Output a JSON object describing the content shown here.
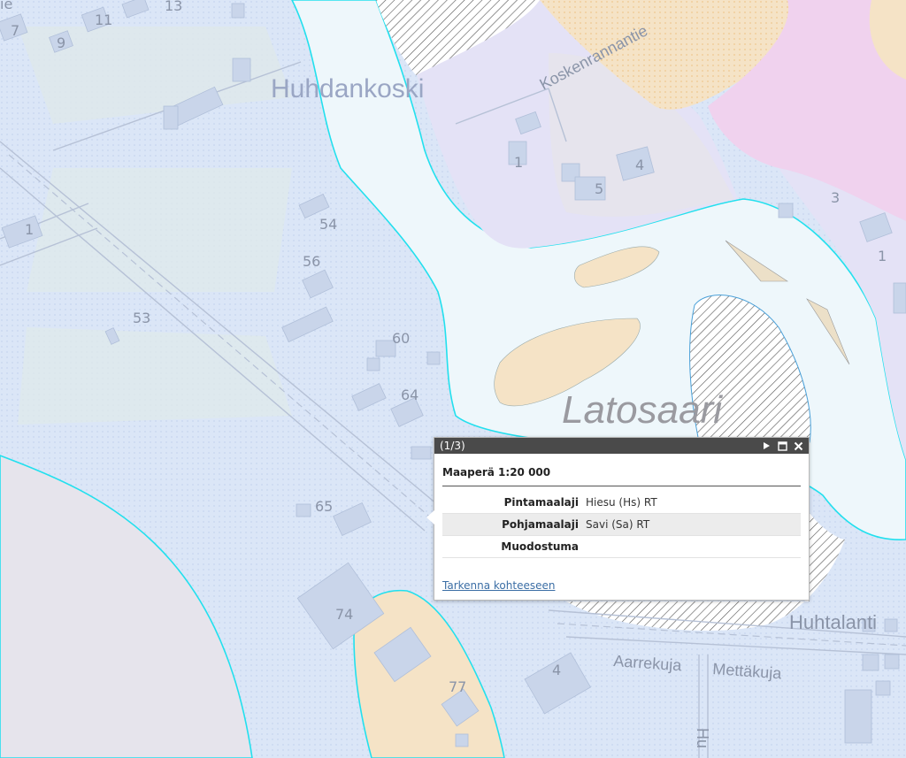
{
  "map": {
    "place_labels": {
      "huhdankoski": "Huhdankoski",
      "latosaari": "Latosaari"
    },
    "road_labels": {
      "koskenrannantie": "Koskenrannantie",
      "huhtalantie": "Huhtalanti",
      "aarrekuja": "Aarrekuja",
      "mettakuja": "Mettäkuja",
      "vertical": "Hu"
    },
    "address_numbers": [
      "7",
      "9",
      "11",
      "13",
      "1",
      "54",
      "56",
      "53",
      "60",
      "64",
      "65",
      "74",
      "77",
      "4",
      "1",
      "5",
      "4",
      "3",
      "1",
      "ie"
    ],
    "colors": {
      "water": "#eef7fb",
      "soil_blue": "#dbe6f7",
      "soil_purple": "#e4e2f6",
      "soil_pink": "#f0d2ee",
      "sand": "#f5e3c6",
      "sand_dots": "#f2cfa0",
      "gray": "#e6e4ec",
      "outline": "#22e0ee"
    }
  },
  "popup": {
    "counter": "(1/3)",
    "title": "Maaperä 1:20 000",
    "rows": [
      {
        "key": "Pintamaalaji",
        "value": "Hiesu (Hs) RT"
      },
      {
        "key": "Pohjamaalaji",
        "value": "Savi (Sa) RT"
      },
      {
        "key": "Muodostuma",
        "value": ""
      }
    ],
    "link": "Tarkenna kohteeseen",
    "icons": {
      "next": "play-icon",
      "maximize": "maximize-icon",
      "close": "close-icon"
    }
  }
}
